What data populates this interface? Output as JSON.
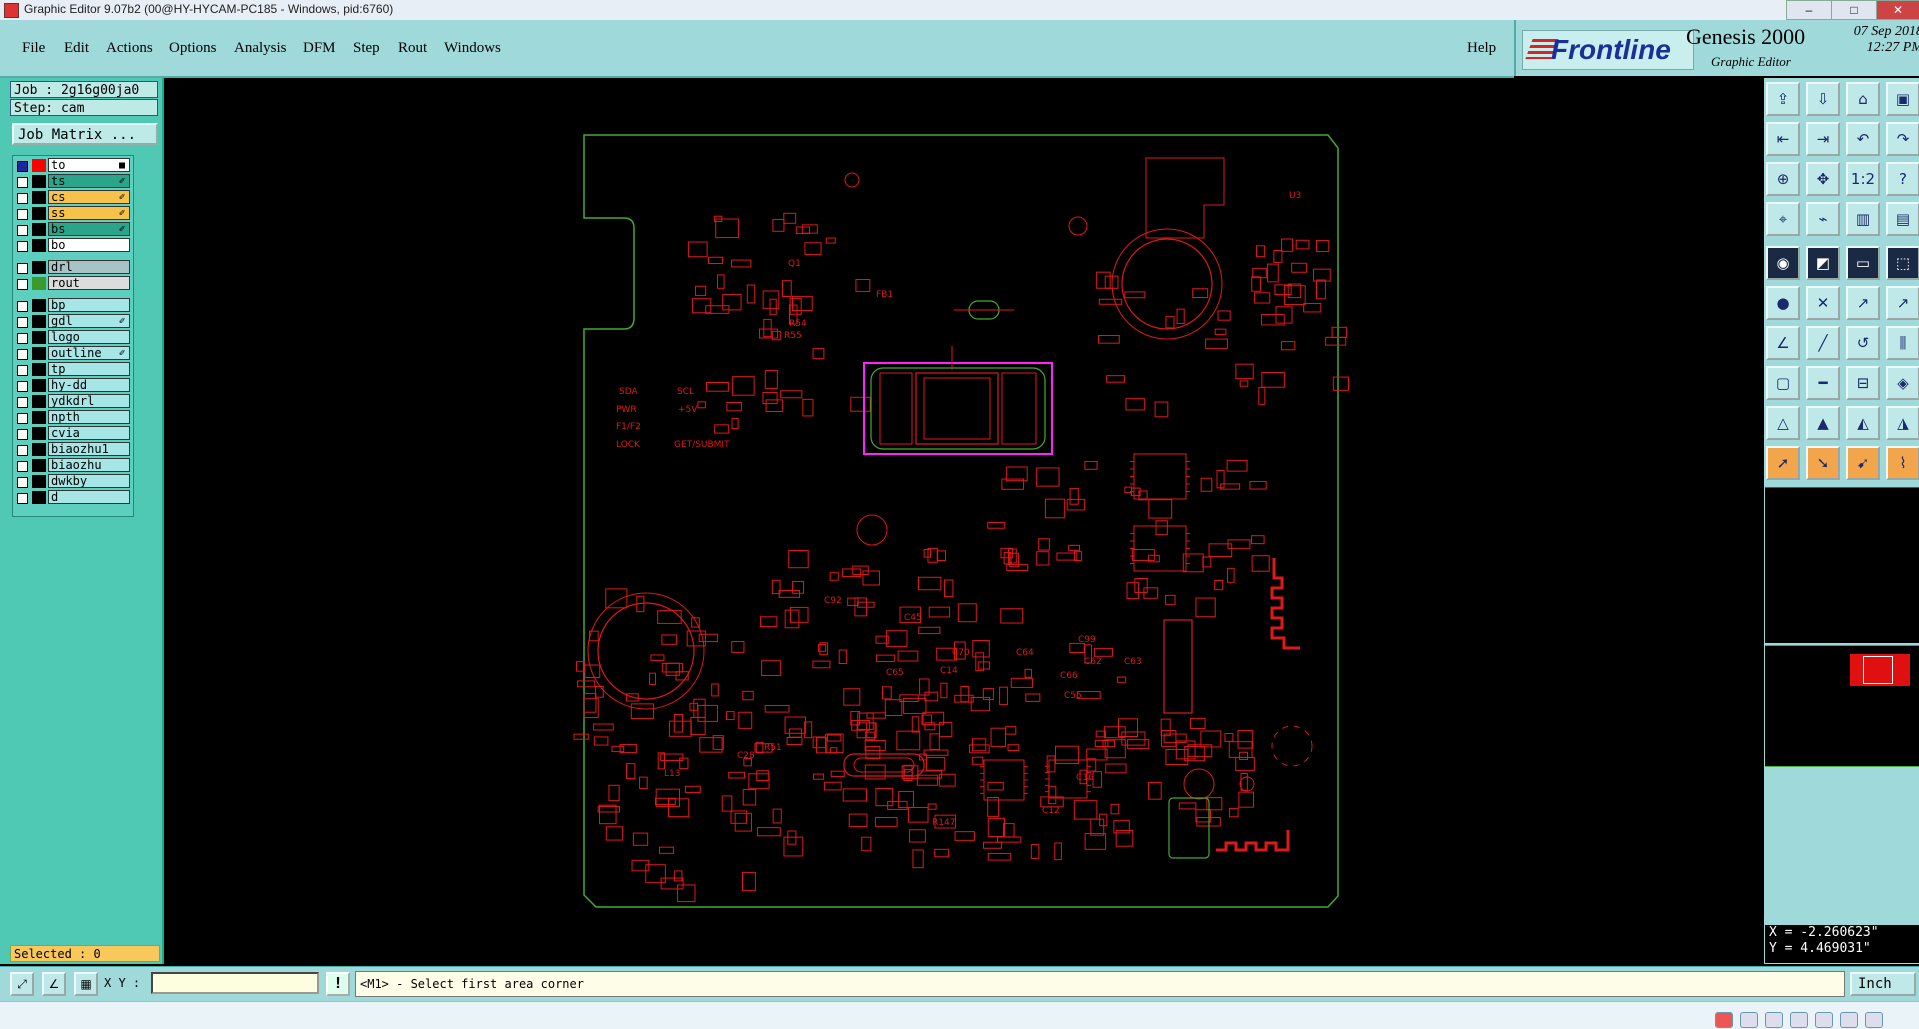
{
  "titlebar": {
    "title": "Graphic Editor 9.07b2 (00@HY-HYCAM-PC185 - Windows, pid:6760)"
  },
  "menu": {
    "items": [
      {
        "label": "File",
        "key": "file"
      },
      {
        "label": "Edit",
        "key": "edit"
      },
      {
        "label": "Actions",
        "key": "actions"
      },
      {
        "label": "Options",
        "key": "options"
      },
      {
        "label": "Analysis",
        "key": "analysis"
      },
      {
        "label": "DFM",
        "key": "dfm"
      },
      {
        "label": "Step",
        "key": "step"
      },
      {
        "label": "Rout",
        "key": "rout"
      },
      {
        "label": "Windows",
        "key": "windows"
      }
    ],
    "help": "Help"
  },
  "brand": {
    "logo": "Frontline",
    "product": "Genesis 2000",
    "subtitle": "Graphic Editor",
    "date": "07 Sep 2018",
    "time": "12:27 PM"
  },
  "job": {
    "job_label": "Job : 2g16g00ja0",
    "step_label": "Step: cam",
    "matrix_button": "Job Matrix ..."
  },
  "layers": [
    {
      "name": "to",
      "color": "#ff0000",
      "bg": "#ffffff",
      "mark": "■",
      "first": true
    },
    {
      "name": "ts",
      "color": "#000000",
      "bg": "#2aa58a",
      "mark": "✐"
    },
    {
      "name": "cs",
      "color": "#000000",
      "bg": "#f6c24a",
      "mark": "✐"
    },
    {
      "name": "ss",
      "color": "#000000",
      "bg": "#f6c24a",
      "mark": "✐"
    },
    {
      "name": "bs",
      "color": "#000000",
      "bg": "#2aa58a",
      "mark": "✐"
    },
    {
      "name": "bo",
      "color": "#000000",
      "bg": "#ffffff",
      "mark": ""
    },
    {
      "name": "drl",
      "color": "#000000",
      "bg": "#a8c3c8",
      "mark": ""
    },
    {
      "name": "rout",
      "color": "#3a9a2a",
      "bg": "#dcdcdc",
      "mark": ""
    },
    {
      "name": "bp",
      "color": "#000000",
      "bg": "#a6e6e6",
      "mark": ""
    },
    {
      "name": "gdl",
      "color": "#000000",
      "bg": "#a6e6e6",
      "mark": "✐"
    },
    {
      "name": "logo",
      "color": "#000000",
      "bg": "#a6e6e6",
      "mark": ""
    },
    {
      "name": "outline",
      "color": "#000000",
      "bg": "#a6e6e6",
      "mark": "✐"
    },
    {
      "name": "tp",
      "color": "#000000",
      "bg": "#a6e6e6",
      "mark": ""
    },
    {
      "name": "hy-dd",
      "color": "#000000",
      "bg": "#a6e6e6",
      "mark": ""
    },
    {
      "name": "ydkdrl",
      "color": "#000000",
      "bg": "#a6e6e6",
      "mark": ""
    },
    {
      "name": "npth",
      "color": "#000000",
      "bg": "#a6e6e6",
      "mark": ""
    },
    {
      "name": "cvia",
      "color": "#000000",
      "bg": "#a6e6e6",
      "mark": ""
    },
    {
      "name": "biaozhu1",
      "color": "#000000",
      "bg": "#a6e6e6",
      "mark": ""
    },
    {
      "name": "biaozhu",
      "color": "#000000",
      "bg": "#a6e6e6",
      "mark": ""
    },
    {
      "name": "dwkby",
      "color": "#000000",
      "bg": "#a6e6e6",
      "mark": ""
    },
    {
      "name": "d",
      "color": "#000000",
      "bg": "#a6e6e6",
      "mark": ""
    }
  ],
  "selected": "Selected : 0",
  "board": {
    "labels": [
      "SDA",
      "SCL",
      "PWR",
      "+5V",
      "F1/F2",
      "LOCK",
      "GET/SUBMIT",
      "C99",
      "C70",
      "C64",
      "C65",
      "C66",
      "C55",
      "C62",
      "C63",
      "C92",
      "C45",
      "C14",
      "C16",
      "C12",
      "R147",
      "R51",
      "C28",
      "L13",
      "U3",
      "Q1",
      "FB1",
      "R54",
      "R55"
    ]
  },
  "coords": {
    "x": "X = -2.260623\"",
    "y": "Y = 4.469031\""
  },
  "bottom": {
    "xy_label": "X Y :",
    "xy_value": "",
    "status": "<M1> - Select first area corner",
    "unit": "Inch"
  },
  "colors": {
    "panel": "#9fd9da",
    "left_panel": "#4fc8b4",
    "outline": "#44aa33",
    "copper": "#dd1a1a",
    "highlight": "#ff22ff"
  }
}
